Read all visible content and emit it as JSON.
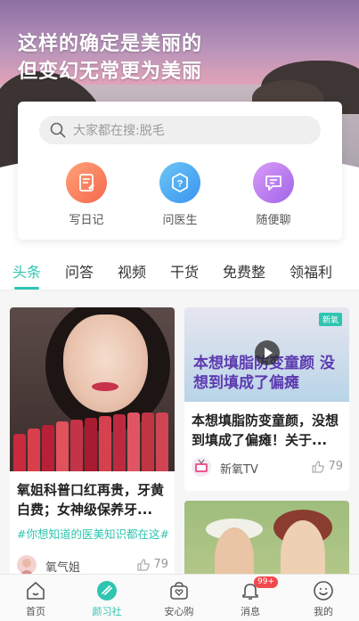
{
  "hero": {
    "slogan_line1": "这样的确定是美丽的",
    "slogan_line2": "但变幻无常更为美丽"
  },
  "search": {
    "placeholder": "大家都在搜:脱毛"
  },
  "quick_actions": [
    {
      "label": "写日记",
      "icon": "diary-icon"
    },
    {
      "label": "问医生",
      "icon": "ask-doctor-icon"
    },
    {
      "label": "随便聊",
      "icon": "chat-icon"
    }
  ],
  "tabs": [
    {
      "label": "头条",
      "active": true
    },
    {
      "label": "问答"
    },
    {
      "label": "视频"
    },
    {
      "label": "干货"
    },
    {
      "label": "免费整"
    },
    {
      "label": "领福利"
    }
  ],
  "posts": [
    {
      "title": "氧姐科普口红再贵，牙黄白费；女神级保养牙...",
      "tag": "#你想知道的医美知识都在这#",
      "author": "氧气姐",
      "likes": "79"
    },
    {
      "image_text": "本想填脂防变童颜 没想到填成了偏瘫",
      "image_logo": "新氧",
      "title": "本想填脂防变童颜，没想到填成了偏瘫！关于...",
      "author": "新氧TV",
      "likes": "79"
    }
  ],
  "bottom_nav": [
    {
      "label": "首页",
      "icon": "home-icon"
    },
    {
      "label": "颜习社",
      "icon": "community-icon",
      "active": true
    },
    {
      "label": "安心购",
      "icon": "shop-icon"
    },
    {
      "label": "消息",
      "icon": "bell-icon",
      "badge": "99+"
    },
    {
      "label": "我的",
      "icon": "profile-icon"
    }
  ],
  "colors": {
    "accent": "#2fc5b0",
    "badge": "#f2494e"
  }
}
